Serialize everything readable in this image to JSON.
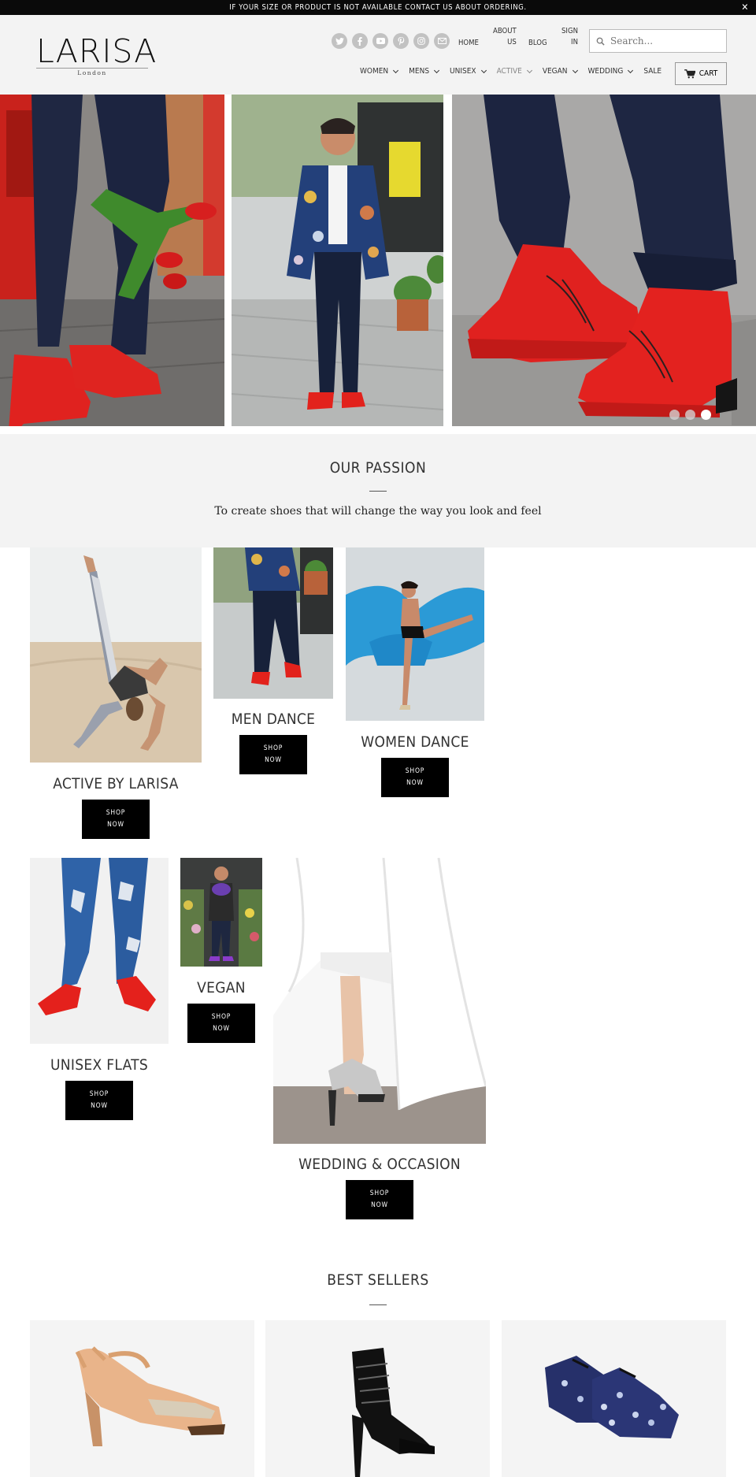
{
  "announcement": {
    "text": "IF YOUR SIZE OR PRODUCT IS NOT AVAILABLE CONTACT US ABOUT ORDERING.",
    "close": "✕"
  },
  "header": {
    "logo_name": "LARISA",
    "logo_sub": "London",
    "socials": [
      "twitter-icon",
      "facebook-icon",
      "youtube-icon",
      "pinterest-icon",
      "instagram-icon",
      "email-icon"
    ],
    "top_links": {
      "home": "HOME",
      "about_1": "ABOUT",
      "about_2": "US",
      "blog": "BLOG",
      "sign_1": "SIGN",
      "sign_2": "IN"
    },
    "search_placeholder": "Search...",
    "nav": [
      {
        "label": "WOMEN",
        "dropdown": true
      },
      {
        "label": "MENS",
        "dropdown": true
      },
      {
        "label": "UNISEX",
        "dropdown": true
      },
      {
        "label": "ACTIVE",
        "dropdown": true,
        "active": true
      },
      {
        "label": "VEGAN",
        "dropdown": true
      },
      {
        "label": "WEDDING",
        "dropdown": true
      },
      {
        "label": "SALE",
        "dropdown": false
      }
    ],
    "cart": "CART"
  },
  "hero": {
    "slide_count": 3,
    "active_slide": 3
  },
  "passion": {
    "title": "OUR PASSION",
    "text": "To create shoes that will change the way you look and feel"
  },
  "collections": {
    "active": {
      "title": "ACTIVE BY LARISA"
    },
    "men": {
      "title": "MEN DANCE"
    },
    "women": {
      "title": "WOMEN DANCE"
    },
    "unisex": {
      "title": "UNISEX FLATS"
    },
    "vegan": {
      "title": "VEGAN"
    },
    "wedding": {
      "title": "WEDDING & OCCASION"
    },
    "shop_line1": "SHOP",
    "shop_line2": "NOW"
  },
  "best_sellers": {
    "title": "BEST SELLERS"
  },
  "colors": {
    "accent_red": "#e02424",
    "navy": "#1c2440",
    "bar": "#0a0a0a",
    "header_bg": "#f3f3f3"
  }
}
